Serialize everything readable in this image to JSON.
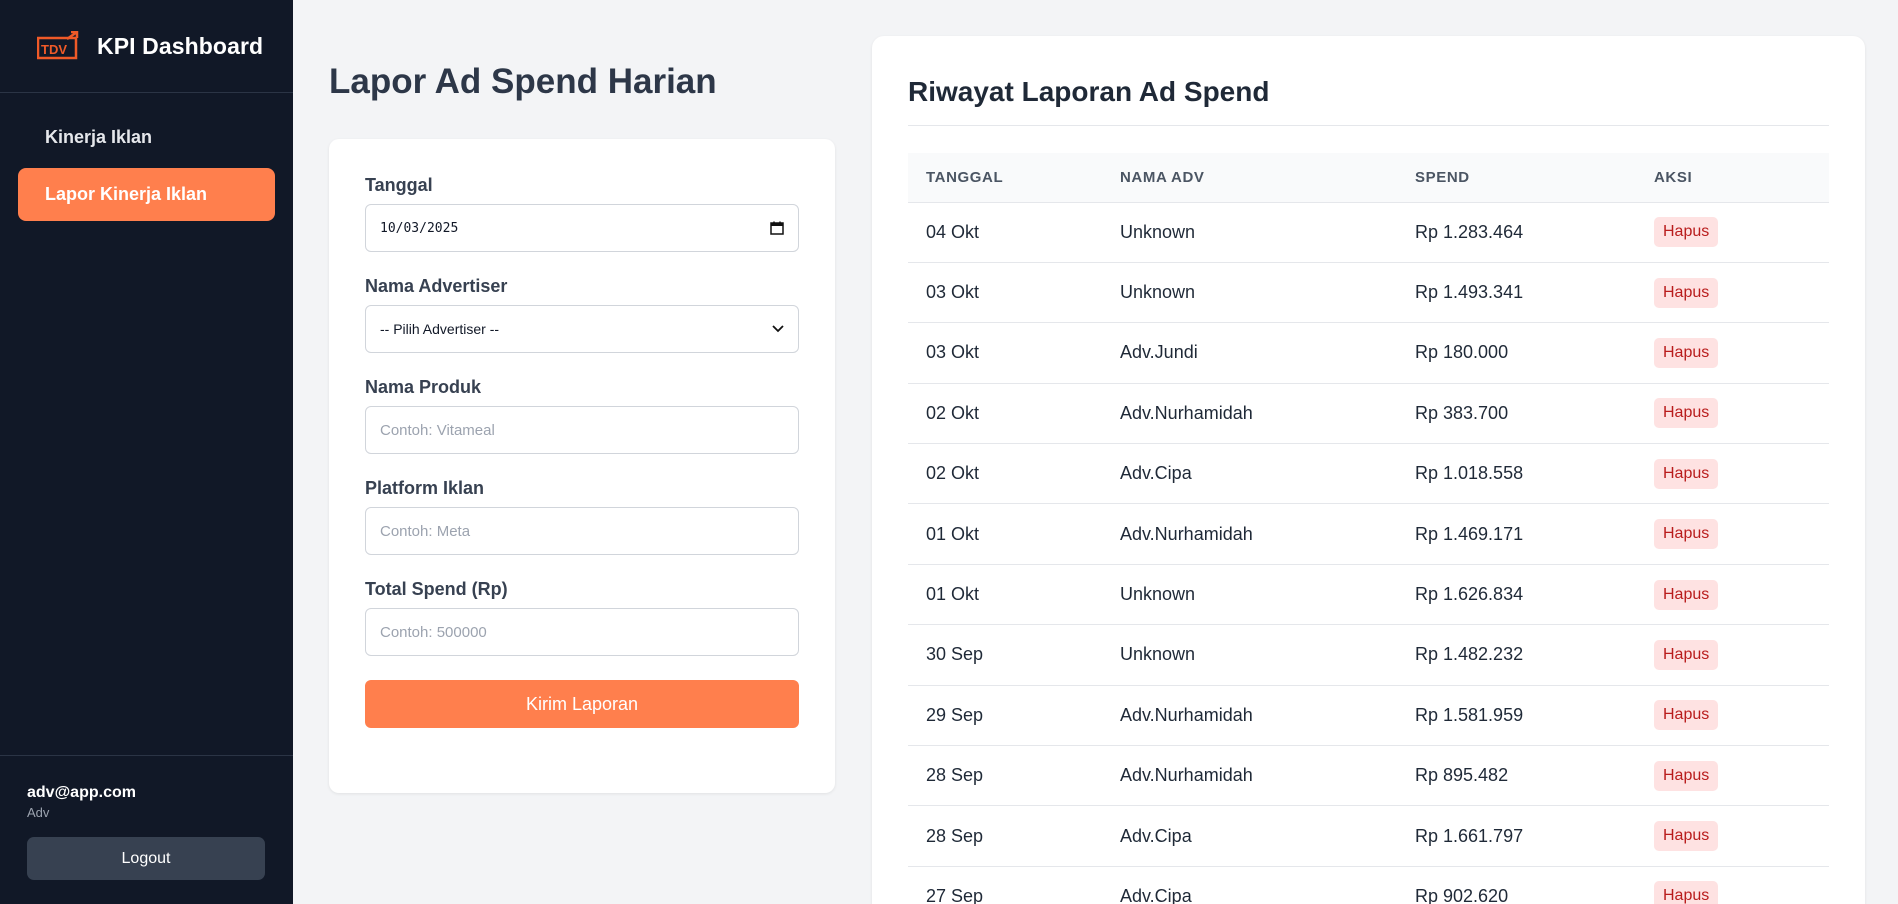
{
  "app": {
    "title": "KPI Dashboard",
    "logo_text": "TDV"
  },
  "sidebar": {
    "items": [
      {
        "label": "Kinerja Iklan",
        "active": false
      },
      {
        "label": "Lapor Kinerja Iklan",
        "active": true
      }
    ],
    "user": {
      "email": "adv@app.com",
      "role": "Adv"
    },
    "logout_label": "Logout"
  },
  "form": {
    "page_title": "Lapor Ad Spend Harian",
    "date": {
      "label": "Tanggal",
      "value": "10/03/2025"
    },
    "advertiser": {
      "label": "Nama Advertiser",
      "value": "-- Pilih Advertiser --"
    },
    "product": {
      "label": "Nama Produk",
      "placeholder": "Contoh: Vitameal"
    },
    "platform": {
      "label": "Platform Iklan",
      "placeholder": "Contoh: Meta"
    },
    "spend": {
      "label": "Total Spend (Rp)",
      "placeholder": "Contoh: 500000"
    },
    "submit_label": "Kirim Laporan"
  },
  "history": {
    "title": "Riwayat Laporan Ad Spend",
    "columns": [
      "TANGGAL",
      "NAMA ADV",
      "SPEND",
      "AKSI"
    ],
    "delete_label": "Hapus",
    "rows": [
      {
        "date": "04 Okt",
        "adv": "Unknown",
        "spend": "Rp 1.283.464"
      },
      {
        "date": "03 Okt",
        "adv": "Unknown",
        "spend": "Rp 1.493.341"
      },
      {
        "date": "03 Okt",
        "adv": "Adv.Jundi",
        "spend": "Rp 180.000"
      },
      {
        "date": "02 Okt",
        "adv": "Adv.Nurhamidah",
        "spend": "Rp 383.700"
      },
      {
        "date": "02 Okt",
        "adv": "Adv.Cipa",
        "spend": "Rp 1.018.558"
      },
      {
        "date": "01 Okt",
        "adv": "Adv.Nurhamidah",
        "spend": "Rp 1.469.171"
      },
      {
        "date": "01 Okt",
        "adv": "Unknown",
        "spend": "Rp 1.626.834"
      },
      {
        "date": "30 Sep",
        "adv": "Unknown",
        "spend": "Rp 1.482.232"
      },
      {
        "date": "29 Sep",
        "adv": "Adv.Nurhamidah",
        "spend": "Rp 1.581.959"
      },
      {
        "date": "28 Sep",
        "adv": "Adv.Nurhamidah",
        "spend": "Rp 895.482"
      },
      {
        "date": "28 Sep",
        "adv": "Adv.Cipa",
        "spend": "Rp 1.661.797"
      },
      {
        "date": "27 Sep",
        "adv": "Adv.Cipa",
        "spend": "Rp 902.620"
      }
    ]
  },
  "colors": {
    "accent": "#ff7f4d",
    "sidebar_bg": "#111827",
    "danger_bg": "#fee2e2",
    "danger_text": "#b91c1c"
  }
}
